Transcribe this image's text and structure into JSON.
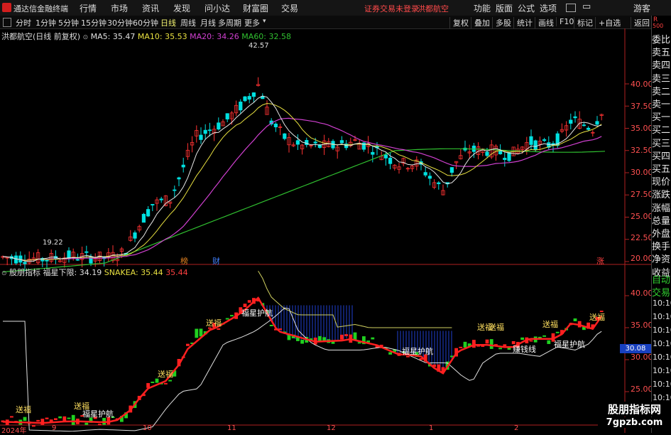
{
  "titlebar": {
    "app_name": "通达信金融终端",
    "menus": [
      "行情",
      "市场",
      "资讯",
      "发现",
      "问小达",
      "财富圈",
      "交易"
    ],
    "login_notice": "证券交易未登录",
    "stock_name": "洪都航空",
    "right_menus": [
      "功能",
      "版面",
      "公式",
      "选项"
    ],
    "guest": "游客"
  },
  "periodbar": {
    "periods": [
      "分时",
      "1分钟",
      "5分钟",
      "15分钟",
      "30分钟",
      "60分钟",
      "日线",
      "周线",
      "月线",
      "多周期",
      "更多"
    ],
    "active": "日线",
    "tools": [
      "复权",
      "叠加",
      "多股",
      "统计",
      "画线",
      "F10",
      "标记",
      "+自选",
      "返回"
    ]
  },
  "main_chart": {
    "title": "洪都航空(日线 前复权)",
    "ma5": "MA5: 35.47",
    "ma10": "MA10: 35.53",
    "ma20": "MA20: 34.26",
    "ma60": "MA60: 32.58",
    "high_label": "42.57",
    "low_label": "19.22",
    "price_axis": [
      "40.00",
      "37.50",
      "35.00",
      "32.50",
      "30.00",
      "27.50",
      "25.00",
      "22.50",
      "20.00"
    ],
    "event_markers": [
      "榜",
      "财",
      "涨"
    ],
    "colors": {
      "up": "#ff3232",
      "down": "#00e0e0",
      "ma5": "#e0e0e0",
      "ma10": "#e8e040",
      "ma20": "#d040d0",
      "ma60": "#30c030"
    }
  },
  "sub_chart": {
    "indicator": "股朋指标",
    "fuxing": "福星下限: 34.19",
    "snakea": "SNAKEA: 35.44",
    "last": "35.44",
    "axis": [
      "40.00",
      "35.00",
      "30.00",
      "25.00"
    ],
    "current_tag": "30.08",
    "labels": [
      "送福",
      "福星护航",
      "送福",
      "福星护航",
      "送福",
      "福星护航",
      "送福",
      "送福",
      "送福",
      "送福",
      "赚钱线",
      "福星护航",
      "送福"
    ],
    "months": [
      "2024年",
      "9",
      "10",
      "11",
      "12",
      "1",
      "2"
    ]
  },
  "side_panel": {
    "badge_r": "R",
    "badge_num": "500",
    "quotes": [
      "委比",
      "卖五",
      "卖四",
      "卖三",
      "卖二",
      "卖一",
      "买一",
      "买二",
      "买三",
      "买四",
      "买五",
      "现价",
      "涨跌",
      "涨幅",
      "总量",
      "外盘",
      "换手",
      "净资",
      "收益"
    ],
    "sub_items": [
      "自动",
      "交易"
    ],
    "times": [
      "10:10",
      "10:10",
      "10:10",
      "10:10",
      "10:10",
      "10:10",
      "10:10",
      "10:10",
      "10:10"
    ]
  },
  "watermark": {
    "line1": "股朋指标网",
    "line2": "7gpzb.com"
  }
}
